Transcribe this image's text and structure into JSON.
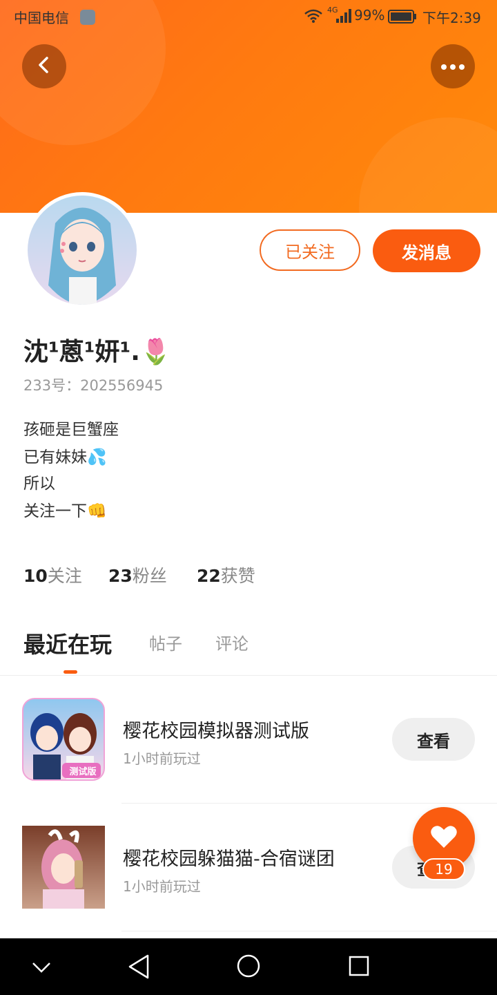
{
  "status_bar": {
    "carrier": "中国电信",
    "network": "4G",
    "battery": "99%",
    "time": "下午2:39"
  },
  "profile": {
    "name": "沈¹蒽¹妍¹.🌷",
    "id_label": "233号：",
    "id_value": "202556945",
    "follow_button": "已关注",
    "message_button": "发消息",
    "bio_lines": [
      "孩砸是巨蟹座",
      "已有妹妹💦",
      "所以",
      "关注一下👊"
    ],
    "stats": [
      {
        "value": "10",
        "label": "关注"
      },
      {
        "value": "23",
        "label": "粉丝"
      },
      {
        "value": "22",
        "label": "获赞"
      }
    ]
  },
  "tabs": [
    {
      "label": "最近在玩",
      "active": true
    },
    {
      "label": "帖子",
      "active": false
    },
    {
      "label": "评论",
      "active": false
    }
  ],
  "games": [
    {
      "title": "樱花校园模拟器测试版",
      "subtitle": "1小时前玩过",
      "button": "查看",
      "badge": "测试版"
    },
    {
      "title": "樱花校园躲猫猫-合宿谜团",
      "subtitle": "1小时前玩过",
      "button": "查看"
    }
  ],
  "like_fab": {
    "count": "19"
  },
  "colors": {
    "accent": "#fa5c10",
    "header": "#ff7a10"
  }
}
